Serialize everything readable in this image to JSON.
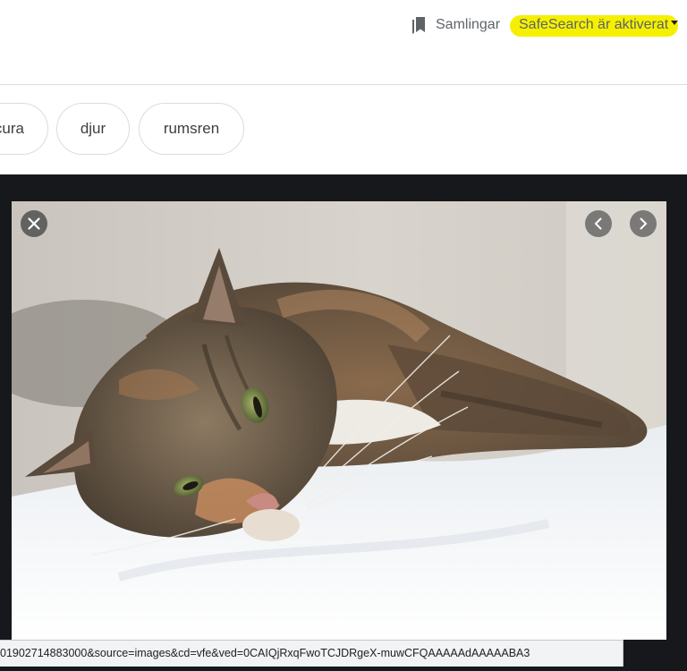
{
  "header": {
    "collections_label": "Samlingar",
    "safesearch_label": "SafeSearch är aktiverat"
  },
  "chips": [
    "cura",
    "djur",
    "rumsren"
  ],
  "viewer": {
    "image_icon": "cat-photo",
    "close_icon": "close-icon",
    "prev_icon": "chevron-left-icon",
    "next_icon": "chevron-right-icon"
  },
  "status_bar": {
    "url": "01902714883000&source=images&cd=vfe&ved=0CAIQjRxqFwoTCJDRgeX-muwCFQAAAAAdAAAAABA3"
  },
  "colors": {
    "highlight": "#f5f000",
    "viewer_bg": "#17181b",
    "text_gray": "#5f6368"
  }
}
